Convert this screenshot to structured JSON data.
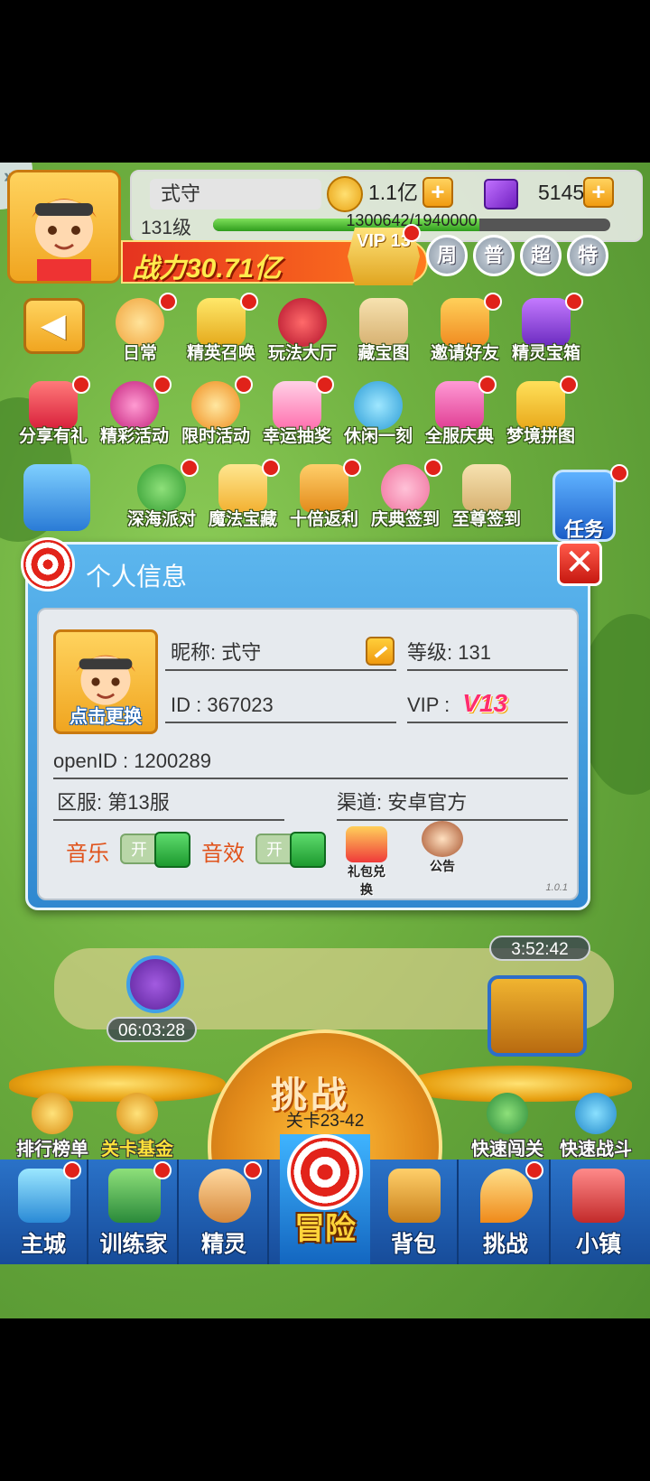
{
  "player": {
    "name": "式守",
    "level_text": "131级",
    "coins": "1.1亿",
    "gems": "51451",
    "exp_text": "1300642/1940000",
    "exp_progress": 0.67,
    "power_text": "战力30.71亿",
    "vip_badge": "VIP 13"
  },
  "round_buttons": [
    "周",
    "普",
    "超",
    "特"
  ],
  "activities_row1": [
    "日常",
    "精英召唤",
    "玩法大厅",
    "藏宝图",
    "邀请好友",
    "精灵宝箱"
  ],
  "activities_row2": [
    "分享有礼",
    "精彩活动",
    "限时活动",
    "幸运抽奖",
    "休闲一刻",
    "全服庆典",
    "梦境拼图"
  ],
  "activities_row3": [
    "深海派对",
    "魔法宝藏",
    "十倍返利",
    "庆典签到",
    "至尊签到"
  ],
  "task_label": "任务",
  "dialog": {
    "title": "个人信息",
    "close": "✕",
    "change_avatar": "点击更换",
    "nickname": "昵称: 式守",
    "level": "等级:  131",
    "id": "ID  : 367023",
    "vip_label": "VIP :",
    "vip_logo": "V13",
    "openid": "openID :  1200289",
    "server": "区服: 第13服",
    "channel": "渠道: 安卓官方",
    "music_label": "音乐",
    "sound_label": "音效",
    "toggle_on": "开",
    "gift_label": "礼包兑换",
    "notice_label": "公告",
    "version": "1.0.1"
  },
  "timers": {
    "left": "06:03:28",
    "right": "3:52:42"
  },
  "challenge": {
    "title": "挑战",
    "stage": "关卡23-42"
  },
  "side_buttons": {
    "rank": "排行榜单",
    "fund": "关卡基金",
    "fast_pass": "快速闯关",
    "fast_battle": "快速战斗"
  },
  "nav": {
    "items": [
      "主城",
      "训练家",
      "精灵",
      "背包",
      "挑战",
      "小镇"
    ],
    "center": "冒险"
  }
}
